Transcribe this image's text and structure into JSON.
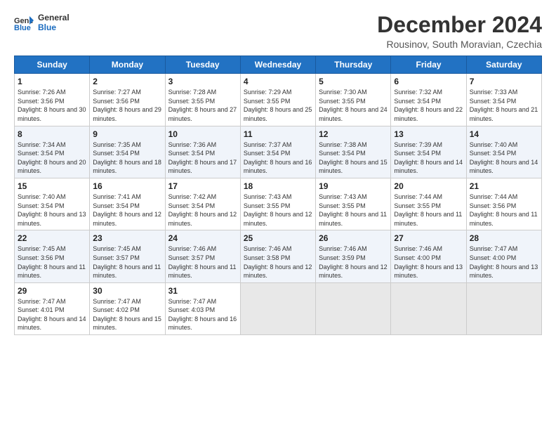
{
  "logo": {
    "line1": "General",
    "line2": "Blue"
  },
  "title": "December 2024",
  "location": "Rousinov, South Moravian, Czechia",
  "days_header": [
    "Sunday",
    "Monday",
    "Tuesday",
    "Wednesday",
    "Thursday",
    "Friday",
    "Saturday"
  ],
  "weeks": [
    [
      {
        "day": "1",
        "sunrise": "Sunrise: 7:26 AM",
        "sunset": "Sunset: 3:56 PM",
        "daylight": "Daylight: 8 hours and 30 minutes."
      },
      {
        "day": "2",
        "sunrise": "Sunrise: 7:27 AM",
        "sunset": "Sunset: 3:56 PM",
        "daylight": "Daylight: 8 hours and 29 minutes."
      },
      {
        "day": "3",
        "sunrise": "Sunrise: 7:28 AM",
        "sunset": "Sunset: 3:55 PM",
        "daylight": "Daylight: 8 hours and 27 minutes."
      },
      {
        "day": "4",
        "sunrise": "Sunrise: 7:29 AM",
        "sunset": "Sunset: 3:55 PM",
        "daylight": "Daylight: 8 hours and 25 minutes."
      },
      {
        "day": "5",
        "sunrise": "Sunrise: 7:30 AM",
        "sunset": "Sunset: 3:55 PM",
        "daylight": "Daylight: 8 hours and 24 minutes."
      },
      {
        "day": "6",
        "sunrise": "Sunrise: 7:32 AM",
        "sunset": "Sunset: 3:54 PM",
        "daylight": "Daylight: 8 hours and 22 minutes."
      },
      {
        "day": "7",
        "sunrise": "Sunrise: 7:33 AM",
        "sunset": "Sunset: 3:54 PM",
        "daylight": "Daylight: 8 hours and 21 minutes."
      }
    ],
    [
      {
        "day": "8",
        "sunrise": "Sunrise: 7:34 AM",
        "sunset": "Sunset: 3:54 PM",
        "daylight": "Daylight: 8 hours and 20 minutes."
      },
      {
        "day": "9",
        "sunrise": "Sunrise: 7:35 AM",
        "sunset": "Sunset: 3:54 PM",
        "daylight": "Daylight: 8 hours and 18 minutes."
      },
      {
        "day": "10",
        "sunrise": "Sunrise: 7:36 AM",
        "sunset": "Sunset: 3:54 PM",
        "daylight": "Daylight: 8 hours and 17 minutes."
      },
      {
        "day": "11",
        "sunrise": "Sunrise: 7:37 AM",
        "sunset": "Sunset: 3:54 PM",
        "daylight": "Daylight: 8 hours and 16 minutes."
      },
      {
        "day": "12",
        "sunrise": "Sunrise: 7:38 AM",
        "sunset": "Sunset: 3:54 PM",
        "daylight": "Daylight: 8 hours and 15 minutes."
      },
      {
        "day": "13",
        "sunrise": "Sunrise: 7:39 AM",
        "sunset": "Sunset: 3:54 PM",
        "daylight": "Daylight: 8 hours and 14 minutes."
      },
      {
        "day": "14",
        "sunrise": "Sunrise: 7:40 AM",
        "sunset": "Sunset: 3:54 PM",
        "daylight": "Daylight: 8 hours and 14 minutes."
      }
    ],
    [
      {
        "day": "15",
        "sunrise": "Sunrise: 7:40 AM",
        "sunset": "Sunset: 3:54 PM",
        "daylight": "Daylight: 8 hours and 13 minutes."
      },
      {
        "day": "16",
        "sunrise": "Sunrise: 7:41 AM",
        "sunset": "Sunset: 3:54 PM",
        "daylight": "Daylight: 8 hours and 12 minutes."
      },
      {
        "day": "17",
        "sunrise": "Sunrise: 7:42 AM",
        "sunset": "Sunset: 3:54 PM",
        "daylight": "Daylight: 8 hours and 12 minutes."
      },
      {
        "day": "18",
        "sunrise": "Sunrise: 7:43 AM",
        "sunset": "Sunset: 3:55 PM",
        "daylight": "Daylight: 8 hours and 12 minutes."
      },
      {
        "day": "19",
        "sunrise": "Sunrise: 7:43 AM",
        "sunset": "Sunset: 3:55 PM",
        "daylight": "Daylight: 8 hours and 11 minutes."
      },
      {
        "day": "20",
        "sunrise": "Sunrise: 7:44 AM",
        "sunset": "Sunset: 3:55 PM",
        "daylight": "Daylight: 8 hours and 11 minutes."
      },
      {
        "day": "21",
        "sunrise": "Sunrise: 7:44 AM",
        "sunset": "Sunset: 3:56 PM",
        "daylight": "Daylight: 8 hours and 11 minutes."
      }
    ],
    [
      {
        "day": "22",
        "sunrise": "Sunrise: 7:45 AM",
        "sunset": "Sunset: 3:56 PM",
        "daylight": "Daylight: 8 hours and 11 minutes."
      },
      {
        "day": "23",
        "sunrise": "Sunrise: 7:45 AM",
        "sunset": "Sunset: 3:57 PM",
        "daylight": "Daylight: 8 hours and 11 minutes."
      },
      {
        "day": "24",
        "sunrise": "Sunrise: 7:46 AM",
        "sunset": "Sunset: 3:57 PM",
        "daylight": "Daylight: 8 hours and 11 minutes."
      },
      {
        "day": "25",
        "sunrise": "Sunrise: 7:46 AM",
        "sunset": "Sunset: 3:58 PM",
        "daylight": "Daylight: 8 hours and 12 minutes."
      },
      {
        "day": "26",
        "sunrise": "Sunrise: 7:46 AM",
        "sunset": "Sunset: 3:59 PM",
        "daylight": "Daylight: 8 hours and 12 minutes."
      },
      {
        "day": "27",
        "sunrise": "Sunrise: 7:46 AM",
        "sunset": "Sunset: 4:00 PM",
        "daylight": "Daylight: 8 hours and 13 minutes."
      },
      {
        "day": "28",
        "sunrise": "Sunrise: 7:47 AM",
        "sunset": "Sunset: 4:00 PM",
        "daylight": "Daylight: 8 hours and 13 minutes."
      }
    ],
    [
      {
        "day": "29",
        "sunrise": "Sunrise: 7:47 AM",
        "sunset": "Sunset: 4:01 PM",
        "daylight": "Daylight: 8 hours and 14 minutes."
      },
      {
        "day": "30",
        "sunrise": "Sunrise: 7:47 AM",
        "sunset": "Sunset: 4:02 PM",
        "daylight": "Daylight: 8 hours and 15 minutes."
      },
      {
        "day": "31",
        "sunrise": "Sunrise: 7:47 AM",
        "sunset": "Sunset: 4:03 PM",
        "daylight": "Daylight: 8 hours and 16 minutes."
      },
      null,
      null,
      null,
      null
    ]
  ]
}
